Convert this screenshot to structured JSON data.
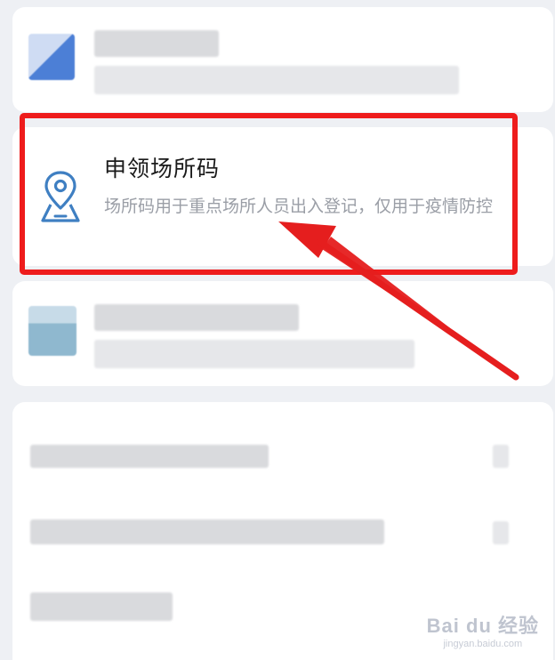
{
  "venue_code_card": {
    "title": "申领场所码",
    "description": "场所码用于重点场所人员出入登记，仅用于疫情防控",
    "icon": "location-pin-icon"
  },
  "colors": {
    "highlight": "#ee1c1c",
    "icon_stroke": "#3f7fc2",
    "title": "#1a1a1a",
    "description": "#9a9ea6",
    "background": "#eef0f4"
  },
  "watermark": {
    "main": "Bai du 经验",
    "sub": "jingyan.baidu.com"
  }
}
